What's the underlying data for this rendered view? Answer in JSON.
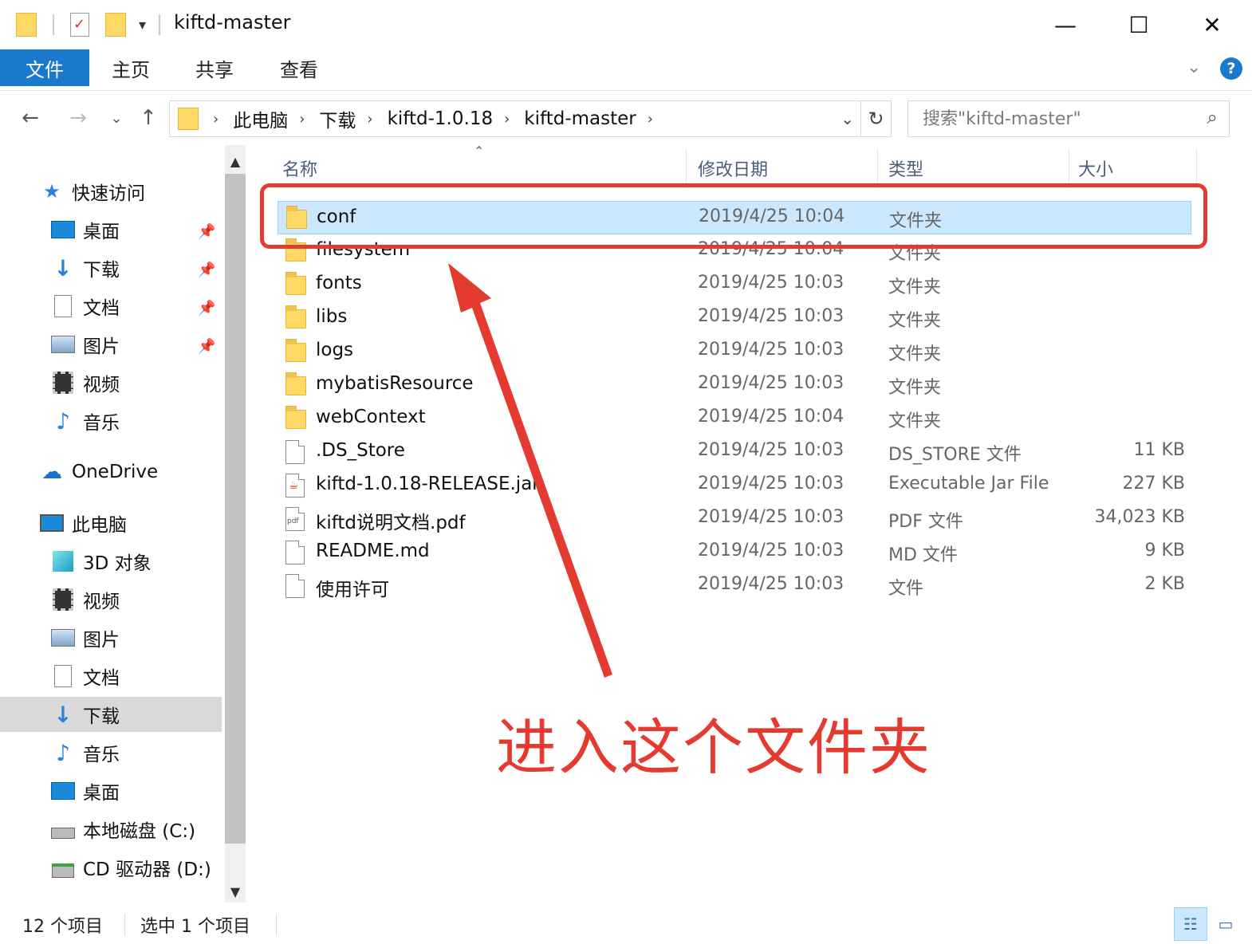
{
  "window": {
    "title": "kiftd-master",
    "minimize": "—",
    "maximize": "☐",
    "close": "✕"
  },
  "ribbon": {
    "tabs": [
      {
        "label": "文件",
        "active": true
      },
      {
        "label": "主页",
        "active": false
      },
      {
        "label": "共享",
        "active": false
      },
      {
        "label": "查看",
        "active": false
      }
    ],
    "expand": "⌄",
    "help": "?"
  },
  "address": {
    "back": "←",
    "forward": "→",
    "recent": "⌄",
    "up": "↑",
    "crumbs": [
      "此电脑",
      "下载",
      "kiftd-1.0.18",
      "kiftd-master"
    ],
    "separator": "›",
    "dropdown": "⌄",
    "refresh": "↻",
    "search_placeholder": "搜索\"kiftd-master\"",
    "search_icon": "search-icon"
  },
  "nav": {
    "quick_access": "快速访问",
    "quick_items": [
      "桌面",
      "下载",
      "文档",
      "图片",
      "视频",
      "音乐"
    ],
    "onedrive": "OneDrive",
    "this_pc": "此电脑",
    "pc_items": [
      "3D 对象",
      "视频",
      "图片",
      "文档",
      "下载",
      "音乐",
      "桌面",
      "本地磁盘 (C:)",
      "CD 驱动器 (D:)"
    ],
    "selected": "下载",
    "pin_icon": "📌"
  },
  "columns": {
    "name": "名称",
    "date": "修改日期",
    "type": "类型",
    "size": "大小"
  },
  "files": [
    {
      "name": "conf",
      "date": "2019/4/25 10:04",
      "type": "文件夹",
      "size": "",
      "kind": "folder",
      "selected": true
    },
    {
      "name": "filesystem",
      "date": "2019/4/25 10:04",
      "type": "文件夹",
      "size": "",
      "kind": "folder"
    },
    {
      "name": "fonts",
      "date": "2019/4/25 10:03",
      "type": "文件夹",
      "size": "",
      "kind": "folder"
    },
    {
      "name": "libs",
      "date": "2019/4/25 10:03",
      "type": "文件夹",
      "size": "",
      "kind": "folder"
    },
    {
      "name": "logs",
      "date": "2019/4/25 10:03",
      "type": "文件夹",
      "size": "",
      "kind": "folder"
    },
    {
      "name": "mybatisResource",
      "date": "2019/4/25 10:03",
      "type": "文件夹",
      "size": "",
      "kind": "folder"
    },
    {
      "name": "webContext",
      "date": "2019/4/25 10:04",
      "type": "文件夹",
      "size": "",
      "kind": "folder"
    },
    {
      "name": ".DS_Store",
      "date": "2019/4/25 10:03",
      "type": "DS_STORE 文件",
      "size": "11 KB",
      "kind": "file"
    },
    {
      "name": "kiftd-1.0.18-RELEASE.jar",
      "date": "2019/4/25 10:03",
      "type": "Executable Jar File",
      "size": "227 KB",
      "kind": "jar"
    },
    {
      "name": "kiftd说明文档.pdf",
      "date": "2019/4/25 10:03",
      "type": "PDF 文件",
      "size": "34,023 KB",
      "kind": "pdf"
    },
    {
      "name": "README.md",
      "date": "2019/4/25 10:03",
      "type": "MD 文件",
      "size": "9 KB",
      "kind": "file"
    },
    {
      "name": "使用许可",
      "date": "2019/4/25 10:03",
      "type": "文件",
      "size": "2 KB",
      "kind": "file"
    }
  ],
  "annotation": {
    "text": "进入这个文件夹",
    "color": "#e53a2f"
  },
  "status": {
    "count": "12 个项目",
    "selected": "选中 1 个项目"
  },
  "colors": {
    "accent": "#1979ca",
    "selection": "#cce8ff",
    "selection_border": "#99d1ff"
  }
}
